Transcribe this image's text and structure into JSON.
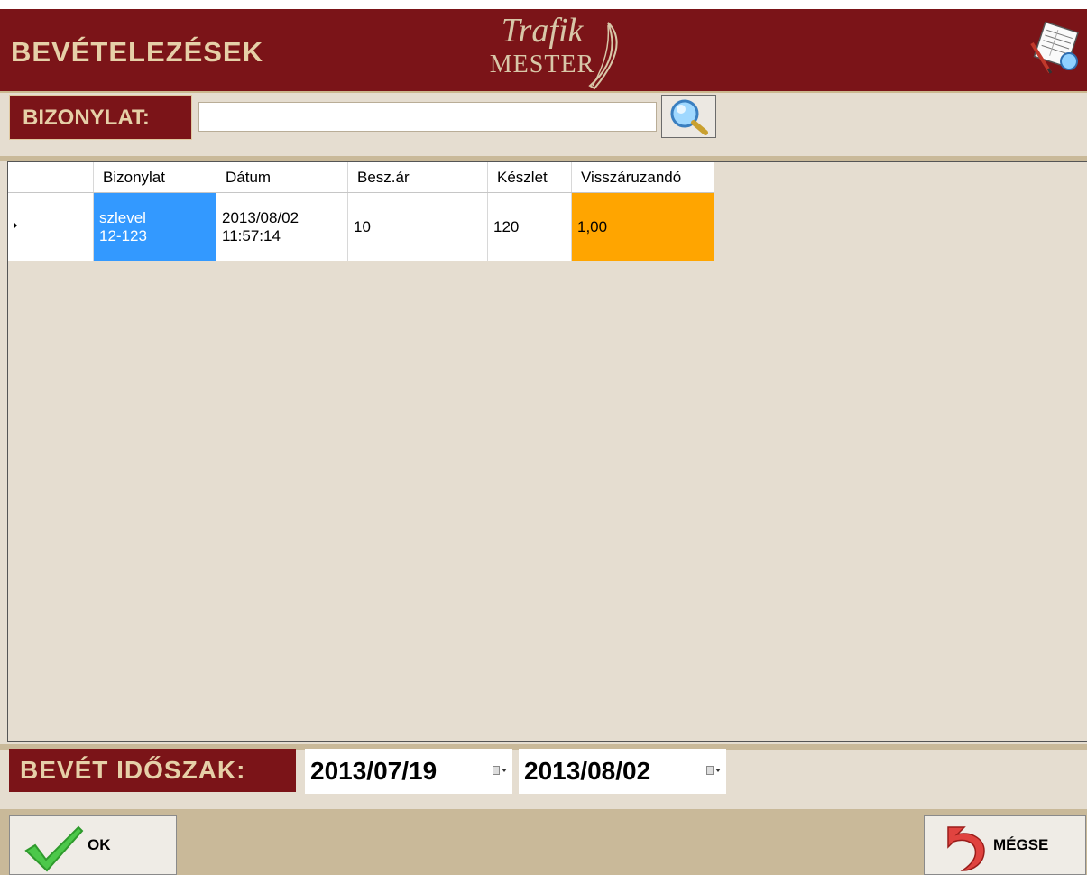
{
  "header": {
    "title": "BEVÉTELEZÉSEK",
    "logo_line1": "Trafik",
    "logo_line2": "MESTER",
    "report_icon": "report-search-icon"
  },
  "search": {
    "label": "BIZONYLAT:",
    "value": "",
    "button_icon": "magnifier-icon"
  },
  "grid": {
    "columns": [
      "Bizonylat",
      "Dátum",
      "Besz.ár",
      "Készlet",
      "Visszáruzandó"
    ],
    "rows": [
      {
        "bizonylat": "szlevel\n12-123",
        "datum": "2013/08/02\n11:57:14",
        "beszar": "10",
        "keszlet": "120",
        "visszaruzando": "1,00"
      }
    ]
  },
  "period": {
    "label": "BEVÉT IDŐSZAK:",
    "from": "2013/07/19",
    "to": "2013/08/02"
  },
  "buttons": {
    "ok": "OK",
    "cancel": "MÉGSE"
  },
  "colors": {
    "header_bg": "#7b1418",
    "label_text": "#e6d0a8",
    "selection": "#3399ff",
    "highlight": "#ffa500",
    "body_bg": "#e5ddd0"
  }
}
